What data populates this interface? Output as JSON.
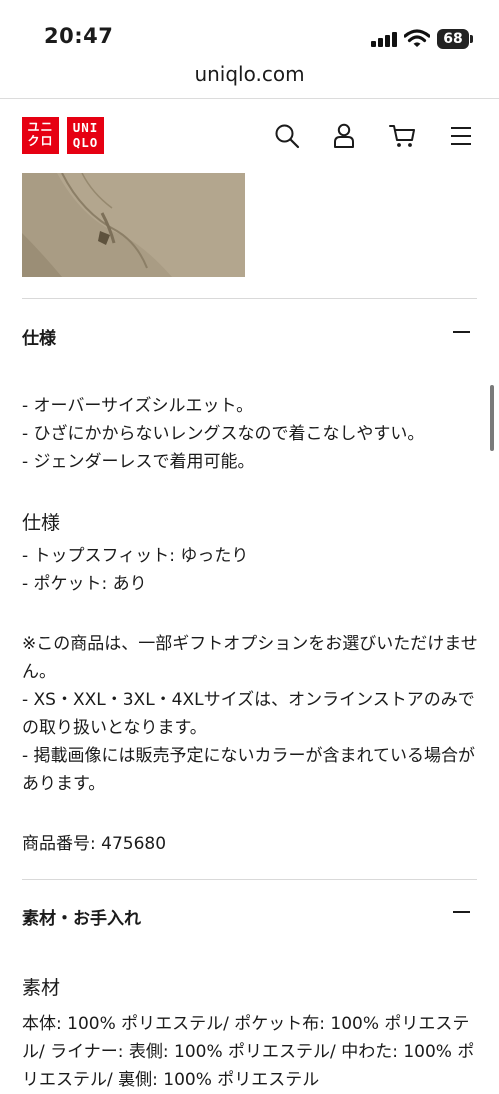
{
  "status": {
    "time": "20:47",
    "battery": "68"
  },
  "browser": {
    "url": "uniqlo.com"
  },
  "header": {
    "logo_jp": "ユニクロ",
    "logo_en": "UNIQLO",
    "icons": [
      "search-icon",
      "account-icon",
      "cart-icon",
      "menu-icon"
    ]
  },
  "spec_section": {
    "title": "仕様",
    "features": "- オーバーサイズシルエット。\n- ひざにかからないレングスなので着こなしやすい。\n- ジェンダーレスで着用可能。",
    "spec_heading": "仕様",
    "spec_list": "- トップスフィット: ゆったり\n- ポケット: あり",
    "notes": "※この商品は、一部ギフトオプションをお選びいただけません。\n- XS・XXL・3XL・4XLサイズは、オンラインストアのみでの取り扱いとなります。\n- 掲載画像には販売予定にないカラーが含まれている場合があります。",
    "product_number": "商品番号: 475680"
  },
  "material_section": {
    "title": "素材・お手入れ",
    "material_heading": "素材",
    "material_text": "本体: 100% ポリエステル/ ポケット布: 100% ポリエステル/ ライナー: 表側: 100% ポリエステル/ 中わた: 100% ポリエステル/ 裏側: 100% ポリエステル"
  },
  "colors": {
    "brand_red": "#e60012",
    "text": "#1b1b1b",
    "divider": "#d9d9d9"
  }
}
